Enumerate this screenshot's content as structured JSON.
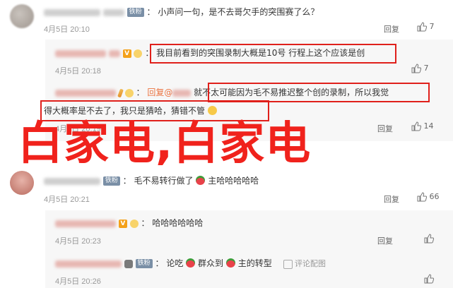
{
  "comments": [
    {
      "badge": "铁粉",
      "text": "小声问一句，是不去哥欠手的突围赛了么？",
      "time": "4月5日 20:10",
      "reply": "回复",
      "likes": "7"
    },
    {
      "text": "我目前看到的突围录制大概是10号 行程上这个应该是创",
      "time": "4月5日 20:18",
      "likes": "7"
    },
    {
      "reply_prefix": "回复@",
      "text1": "就不太可能因为毛不易推迟整个创的录制，所以我觉",
      "text2": "得大概率是不去了，我只是猜哈，猜错不管",
      "time": "4月5日 20:19",
      "reply": "回复",
      "likes": "14"
    },
    {
      "badge": "铁粉",
      "text_a": "毛不易转行做了",
      "text_b": "主哈哈哈哈哈",
      "time": "4月5日 20:21",
      "reply": "回复",
      "likes": "66"
    },
    {
      "text": "哈哈哈哈哈哈",
      "time": "4月5日 20:23",
      "reply": "回复"
    },
    {
      "badge": "铁粉",
      "text_a": "论吃",
      "text_b": "群众到",
      "text_c": "主的转型",
      "report": "评论配图",
      "time": "4月5日 20:26"
    }
  ],
  "watermark": "白家电,白家电",
  "colors": {
    "highlight_box": "#e0201b",
    "watermark": "#f0221c",
    "mention": "#eb7340",
    "fan_badge": "#7a8fa6",
    "vip_badge": "#f4a11a"
  },
  "icons": {
    "like": "thumbs-up-icon",
    "vip": "vip-badge-icon",
    "emoji_grin": "grinning-face-icon",
    "emoji_melon": "watermelon-icon",
    "report": "image-report-icon"
  }
}
